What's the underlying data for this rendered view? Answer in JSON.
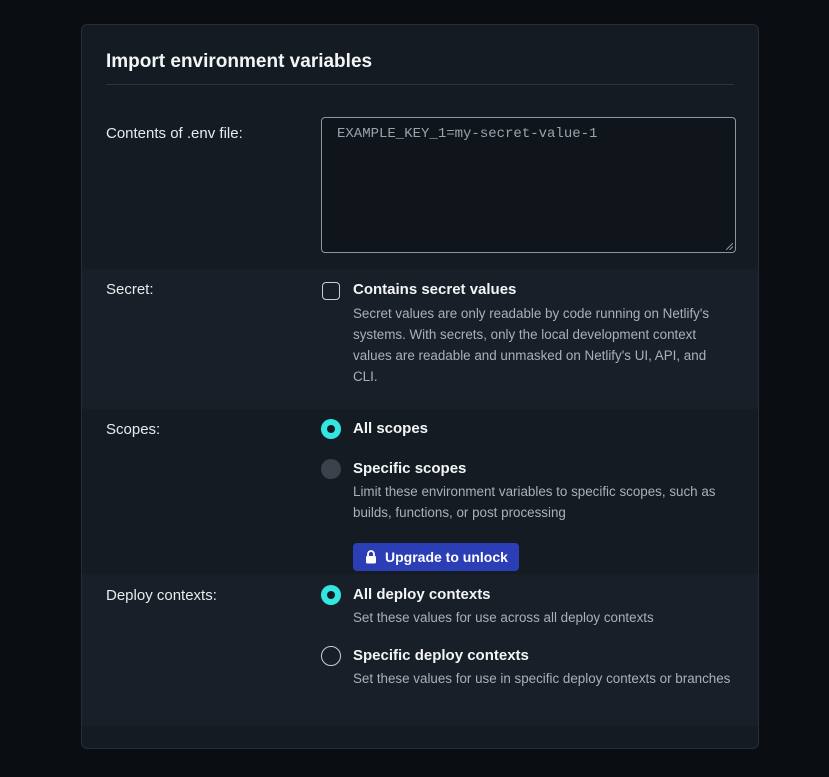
{
  "dialog": {
    "title": "Import environment variables"
  },
  "env_file": {
    "label": "Contents of .env file:",
    "value": "EXAMPLE_KEY_1=my-secret-value-1"
  },
  "secret": {
    "label": "Secret:",
    "checkbox_label": "Contains secret values",
    "checked": false,
    "description": "Secret values are only readable by code running on Netlify's systems. With secrets, only the local development context values are readable and unmasked on Netlify's UI, API, and CLI."
  },
  "scopes": {
    "label": "Scopes:",
    "options": [
      {
        "label": "All scopes",
        "selected": true
      },
      {
        "label": "Specific scopes",
        "selected": false,
        "disabled": true,
        "description": "Limit these environment variables to specific scopes, such as builds, functions, or post processing"
      }
    ],
    "upgrade_button": {
      "label": "Upgrade to unlock",
      "icon": "lock-icon"
    }
  },
  "deploy_contexts": {
    "label": "Deploy contexts:",
    "options": [
      {
        "label": "All deploy contexts",
        "selected": true,
        "description": "Set these values for use across all deploy contexts"
      },
      {
        "label": "Specific deploy contexts",
        "selected": false,
        "description": "Set these values for use in specific deploy contexts or branches"
      }
    ]
  },
  "colors": {
    "accent_teal": "#32e6e2",
    "upgrade_blue": "#2b3eb6",
    "background": "#0a0d11",
    "card": "#151b23"
  }
}
